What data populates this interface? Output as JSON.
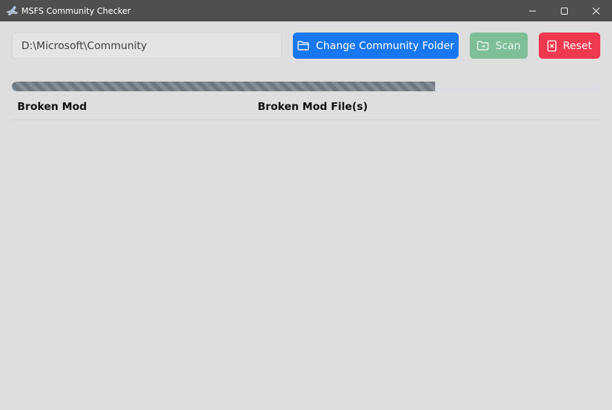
{
  "window": {
    "title": "MSFS Community Checker"
  },
  "toolbar": {
    "path_value": "D:\\Microsoft\\Community",
    "change_folder_label": "Change Community Folder",
    "scan_label": "Scan",
    "reset_label": "Reset"
  },
  "progress": {
    "fraction": 0.72
  },
  "table": {
    "columns": [
      "Broken Mod",
      "Broken Mod File(s)"
    ],
    "rows": []
  },
  "colors": {
    "titlebar": "#4f4f4f",
    "background": "#dedede",
    "primary": "#1877f2",
    "scan": "#7ebf97",
    "danger": "#f0394e",
    "progress": "#6f7781"
  },
  "icons": {
    "app": "plane-icon",
    "change_folder": "folder-icon",
    "scan": "folder-scan-icon",
    "reset": "file-x-icon"
  }
}
